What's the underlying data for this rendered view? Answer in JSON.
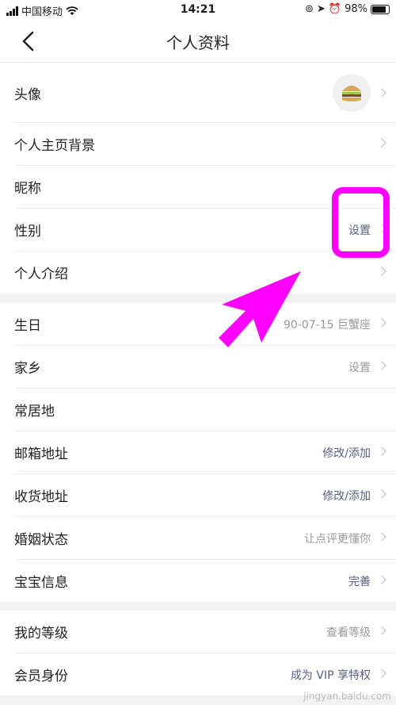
{
  "status_bar": {
    "carrier": "中国移动",
    "time": "14:21",
    "battery": "98%"
  },
  "nav": {
    "title": "个人资料"
  },
  "sections": [
    {
      "items": [
        {
          "label": "头像",
          "value": ""
        },
        {
          "label": "个人主页背景",
          "value": ""
        },
        {
          "label": "昵称",
          "value": ""
        },
        {
          "label": "性别",
          "value": "设置"
        },
        {
          "label": "个人介绍",
          "value": ""
        }
      ]
    },
    {
      "items": [
        {
          "label": "生日",
          "value": "90-07-15 巨蟹座"
        },
        {
          "label": "家乡",
          "value": "设置"
        },
        {
          "label": "常居地",
          "value": ""
        },
        {
          "label": "邮箱地址",
          "value": "修改/添加"
        },
        {
          "label": "收货地址",
          "value": "修改/添加"
        },
        {
          "label": "婚姻状态",
          "value": "让点评更懂你"
        },
        {
          "label": "宝宝信息",
          "value": "完善"
        }
      ]
    },
    {
      "items": [
        {
          "label": "我的等级",
          "value": "查看等级"
        },
        {
          "label": "会员身份",
          "value": "成为 VIP 享特权"
        }
      ]
    }
  ],
  "watermark": "jingyan.baidu.com",
  "colors": {
    "highlight": "#ff00ff",
    "link_value": "#555e80"
  }
}
